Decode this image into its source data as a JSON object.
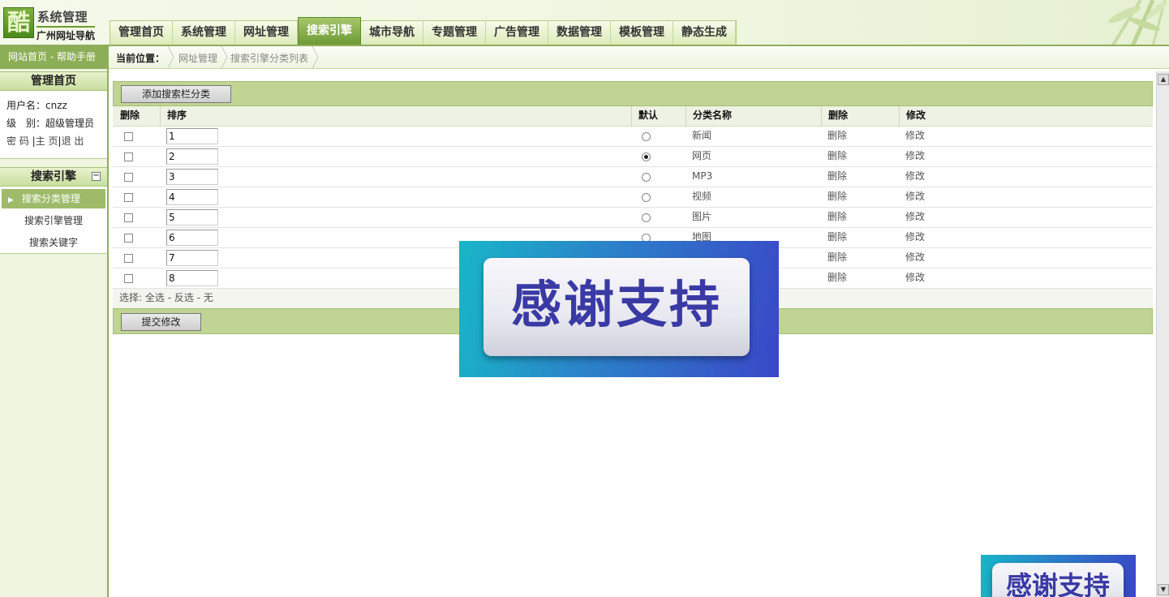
{
  "logo": {
    "glyph": "酷",
    "title": "系统管理",
    "subtitle": "广州网址导航"
  },
  "nav": {
    "tabs": [
      {
        "label": "管理首页",
        "active": false
      },
      {
        "label": "系统管理",
        "active": false
      },
      {
        "label": "网址管理",
        "active": false
      },
      {
        "label": "搜索引擎",
        "active": true
      },
      {
        "label": "城市导航",
        "active": false
      },
      {
        "label": "专题管理",
        "active": false
      },
      {
        "label": "广告管理",
        "active": false
      },
      {
        "label": "数据管理",
        "active": false
      },
      {
        "label": "模板管理",
        "active": false
      },
      {
        "label": "静态生成",
        "active": false
      }
    ]
  },
  "sidebar": {
    "top_links": {
      "home": "网站首页",
      "sep": " - ",
      "help": "帮助手册"
    },
    "admin_title": "管理首页",
    "user_label": "用户名：",
    "user_value": "cnzz",
    "level_label": "级　别：",
    "level_value": "超级管理员",
    "links": {
      "password": "密 码",
      "home": "主 页",
      "logout": "退 出"
    },
    "section_title": "搜索引擎",
    "collapse_glyph": "−",
    "menu": [
      {
        "label": "搜索分类管理",
        "active": true
      },
      {
        "label": "搜索引擎管理",
        "active": false
      },
      {
        "label": "搜索关键字",
        "active": false
      }
    ]
  },
  "breadcrumb": {
    "label": "当前位置：",
    "items": [
      "网址管理",
      "搜索引擎分类列表"
    ]
  },
  "toolbar": {
    "add_button": "添加搜索栏分类"
  },
  "table": {
    "headers": {
      "delete": "删除",
      "order": "排序",
      "default": "默认",
      "name": "分类名称",
      "delete2": "删除",
      "edit": "修改"
    },
    "rows": [
      {
        "order": "1",
        "default": false,
        "name": "新闻",
        "delete": "删除",
        "edit": "修改"
      },
      {
        "order": "2",
        "default": true,
        "name": "网页",
        "delete": "删除",
        "edit": "修改"
      },
      {
        "order": "3",
        "default": false,
        "name": "MP3",
        "delete": "删除",
        "edit": "修改"
      },
      {
        "order": "4",
        "default": false,
        "name": "视频",
        "delete": "删除",
        "edit": "修改"
      },
      {
        "order": "5",
        "default": false,
        "name": "图片",
        "delete": "删除",
        "edit": "修改"
      },
      {
        "order": "6",
        "default": false,
        "name": "地图",
        "delete": "删除",
        "edit": "修改"
      },
      {
        "order": "7",
        "default": false,
        "name": "",
        "delete": "删除",
        "edit": "修改"
      },
      {
        "order": "8",
        "default": false,
        "name": "",
        "delete": "删除",
        "edit": "修改"
      }
    ]
  },
  "select_row": {
    "label": "选择:",
    "all": "全选",
    "invert": "反选",
    "none": "无",
    "sep": " - "
  },
  "footer": {
    "submit_button": "提交修改"
  },
  "overlays": {
    "banner_text": "感谢支持"
  },
  "colors": {
    "accent_green": "#8cae57",
    "toolbar_green": "#c0d494",
    "banner_blue": "#3a47c8",
    "banner_text": "#3a3aa5"
  }
}
